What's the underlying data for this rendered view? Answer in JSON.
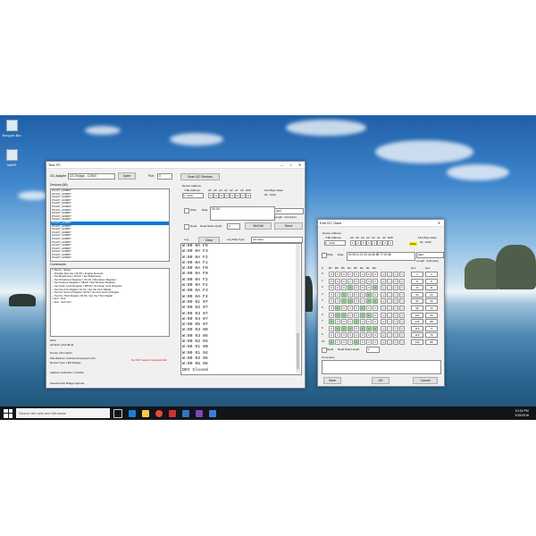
{
  "desktop": {
    "icons": [
      {
        "label": "Recycle Bin",
        "icon": "recycle-bin-icon"
      },
      {
        "label": "Intel®",
        "icon": "file-icon"
      }
    ]
  },
  "taskbar": {
    "search_placeholder": "Search the web and Windows",
    "time": "10:16 PM",
    "date": "2/15/2016",
    "apps": [
      "task-view-icon",
      "edge-icon",
      "explorer-icon",
      "chrome-icon",
      "app-icon",
      "store-icon",
      "visual-studio-icon",
      "media-icon"
    ]
  },
  "win1": {
    "title": "Test I²C",
    "adapter_label": "I2C Adapter",
    "adapter_value": "I2C Bridge - COM3",
    "open_label": "Open",
    "port_label": "Port",
    "port_value": "0",
    "devices_label": "Devices (89)",
    "devices": [
      "PCA9?_A0998?",
      "PCA9?_A0998?",
      "PCA9?_A0998?",
      "PCA9?_A0998?",
      "PCA9?_A0998?",
      "PCA9?_A09983",
      "PCA9?_A0998?",
      "PCA9?_A0998?",
      "PCA9?_A0998?",
      "PCA9?_A0998?",
      "PCA9?_A0998?",
      "PCA9?_A0998?",
      "PCA9?_A0998?",
      "PCA9?_A0998?",
      "PCA9?_A0998?",
      "PCA9?_A0998?",
      "PCA9?_A0998?",
      "PCA9?_A0998?",
      "PCA9?_A0998?",
      "PCA9?_A0998?",
      "PCA9?_A0998?",
      "PCA9?_A0998?"
    ],
    "selected_device_index": 10,
    "commands_label": "Commands",
    "commands": [
      "□ Setup - Setup",
      "   ─ Disable Decode | 00:FF | Enable Decode",
      "   ─ Set Brightness | 0A:FF | Set Brightness",
      "   ─ Set Shutdown Register | 0C:01 | Shutdown Register",
      "   ─ Set Feature Register | 0E:00 | Set Feature Register",
      "   ─ Set Scan Limit Register | 0B:03 | Set Scan Limit Register",
      "─ Set the First Digital | 01:01 | Set the First Digital",
      "─ Set the Second Digital | 02:02 | Set the Second Digital",
      "─ Set the Third Digital | 03:03 | Set the Third Digital",
      "□ Exit - Exit",
      "   ─ Exit - Exit Scrl"
    ],
    "mid_label": "MCU",
    "mid_value": "A0:1101_0C0:36 all",
    "devinfo_label": "Device Information",
    "manufacturer": "Manufactory: Austriamicrosystems AG",
    "device_type": "Device Type: LED Display",
    "warning": "Do NOT support General Call",
    "address": "Address Collection: 0 (0x00)",
    "status": "Selected I2C Bridge Opened.",
    "scan_label": "Scan I2C Devices",
    "device_address_label": "Device Address",
    "bit_address_label": "7-Bit Address",
    "bit_address_value": "0 - 0x00",
    "bit_cols": [
      "A6",
      "A5",
      "A4",
      "A3",
      "A2",
      "A1",
      "A0",
      "R/W"
    ],
    "bits": [
      "0",
      "0",
      "0",
      "0",
      "0",
      "0",
      "0",
      "0"
    ],
    "write_tag": "Write",
    "first_byte_label": "First Byte Value",
    "first_byte_value": "00 - 0x00",
    "write_label": "Write",
    "data_label": "Data",
    "data_value": "00 00",
    "format_value": "HEX",
    "length_label": "Length : 0x2 (Hex)",
    "read_label": "Read",
    "read_len_label": "Read Data Length",
    "read_len_value": "0",
    "biteditor_label": "Bit Edit",
    "send_label": "Send",
    "log_label": "Log",
    "clear_label": "Clear",
    "log_type_label": "Log Data Type",
    "log_type_value": "I2C Data",
    "log": [
      "W:00 0A F9",
      "W:00 0A F3",
      "W:00 0A F2",
      "W:00 0A F1",
      "W:00 0A F0",
      "W:00 0A F0",
      "W:00 0A F1",
      "W:00 0A F2",
      "W:00 0A F3",
      "W:00 0A F4",
      "W:00 01 07",
      "W:00 02 07",
      "W:00 03 07",
      "W:00 04 07",
      "W:00 05 07",
      "W:00 03 00",
      "W:00 03 05",
      "W:00 02 04",
      "W:00 01 00",
      "W:00 01 04",
      "W:00 03 05",
      "W:00 05 06",
      "DEV Closed"
    ]
  },
  "win2": {
    "title": "Edit I2C Data",
    "device_address_label": "Device Address",
    "bit_address_label": "7-Bit Address",
    "bit_address_value": "0 - 0x00",
    "bit_cols": [
      "A6",
      "A5",
      "A4",
      "A3",
      "A2",
      "A1",
      "A0",
      "R/W"
    ],
    "bits": [
      "0",
      "0",
      "0",
      "0",
      "0",
      "0",
      "0",
      "0"
    ],
    "write_tag": "Write",
    "first_byte_label": "First Byte Value",
    "first_byte_value": "00 - 0x00",
    "write_label": "Write",
    "data_label": "Data",
    "data_value": "00 08 11 22 33 44 66 88 77 00 88",
    "format_value": "HEX",
    "length_label": "Length : 0xB (Hex)",
    "grid_headers": [
      "#",
      "B7",
      "B6",
      "B5",
      "B4",
      "B3",
      "B2",
      "B1",
      "B0",
      "",
      "",
      "",
      "",
      "Dec",
      "Hex"
    ],
    "rows": [
      {
        "n": "0",
        "bits": [
          "0",
          "0",
          "0",
          "0",
          "0",
          "0",
          "0",
          "0"
        ],
        "dec": "1",
        "hex": "1"
      },
      {
        "n": "1",
        "bits": [
          "0",
          "0",
          "0",
          "0",
          "0",
          "0",
          "0",
          "0"
        ],
        "dec": "8",
        "hex": "8"
      },
      {
        "n": "2",
        "bits": [
          "0",
          "0",
          "0",
          "1",
          "0",
          "0",
          "0",
          "1"
        ],
        "dec": "17",
        "hex": "11"
      },
      {
        "n": "3",
        "bits": [
          "0",
          "0",
          "1",
          "0",
          "0",
          "0",
          "1",
          "0"
        ],
        "dec": "34",
        "hex": "22"
      },
      {
        "n": "4",
        "bits": [
          "0",
          "0",
          "1",
          "1",
          "0",
          "0",
          "1",
          "1"
        ],
        "dec": "51",
        "hex": "33"
      },
      {
        "n": "5",
        "bits": [
          "0",
          "1",
          "0",
          "0",
          "0",
          "1",
          "0",
          "0"
        ],
        "dec": "68",
        "hex": "44"
      },
      {
        "n": "6",
        "bits": [
          "0",
          "1",
          "1",
          "0",
          "0",
          "1",
          "1",
          "0"
        ],
        "dec": "102",
        "hex": "66"
      },
      {
        "n": "7",
        "bits": [
          "1",
          "0",
          "0",
          "0",
          "1",
          "0",
          "0",
          "0"
        ],
        "dec": "136",
        "hex": "88"
      },
      {
        "n": "8",
        "bits": [
          "0",
          "1",
          "1",
          "1",
          "0",
          "1",
          "1",
          "1"
        ],
        "dec": "119",
        "hex": "77"
      },
      {
        "n": "9",
        "bits": [
          "0",
          "0",
          "0",
          "0",
          "0",
          "0",
          "0",
          "0"
        ],
        "dec": "118",
        "hex": "76"
      },
      {
        "n": "10",
        "bits": [
          "1",
          "0",
          "0",
          "0",
          "1",
          "0",
          "0",
          "0"
        ],
        "dec": "136",
        "hex": "88"
      }
    ],
    "op_symbols": [
      "+",
      "-",
      "<",
      ">"
    ],
    "read_label": "Read",
    "read_len_label": "Read Data Length",
    "read_len_value": "0",
    "comments_label": "Comments",
    "save_label": "Save",
    "ok_label": "OK",
    "cancel_label": "Cancel"
  }
}
